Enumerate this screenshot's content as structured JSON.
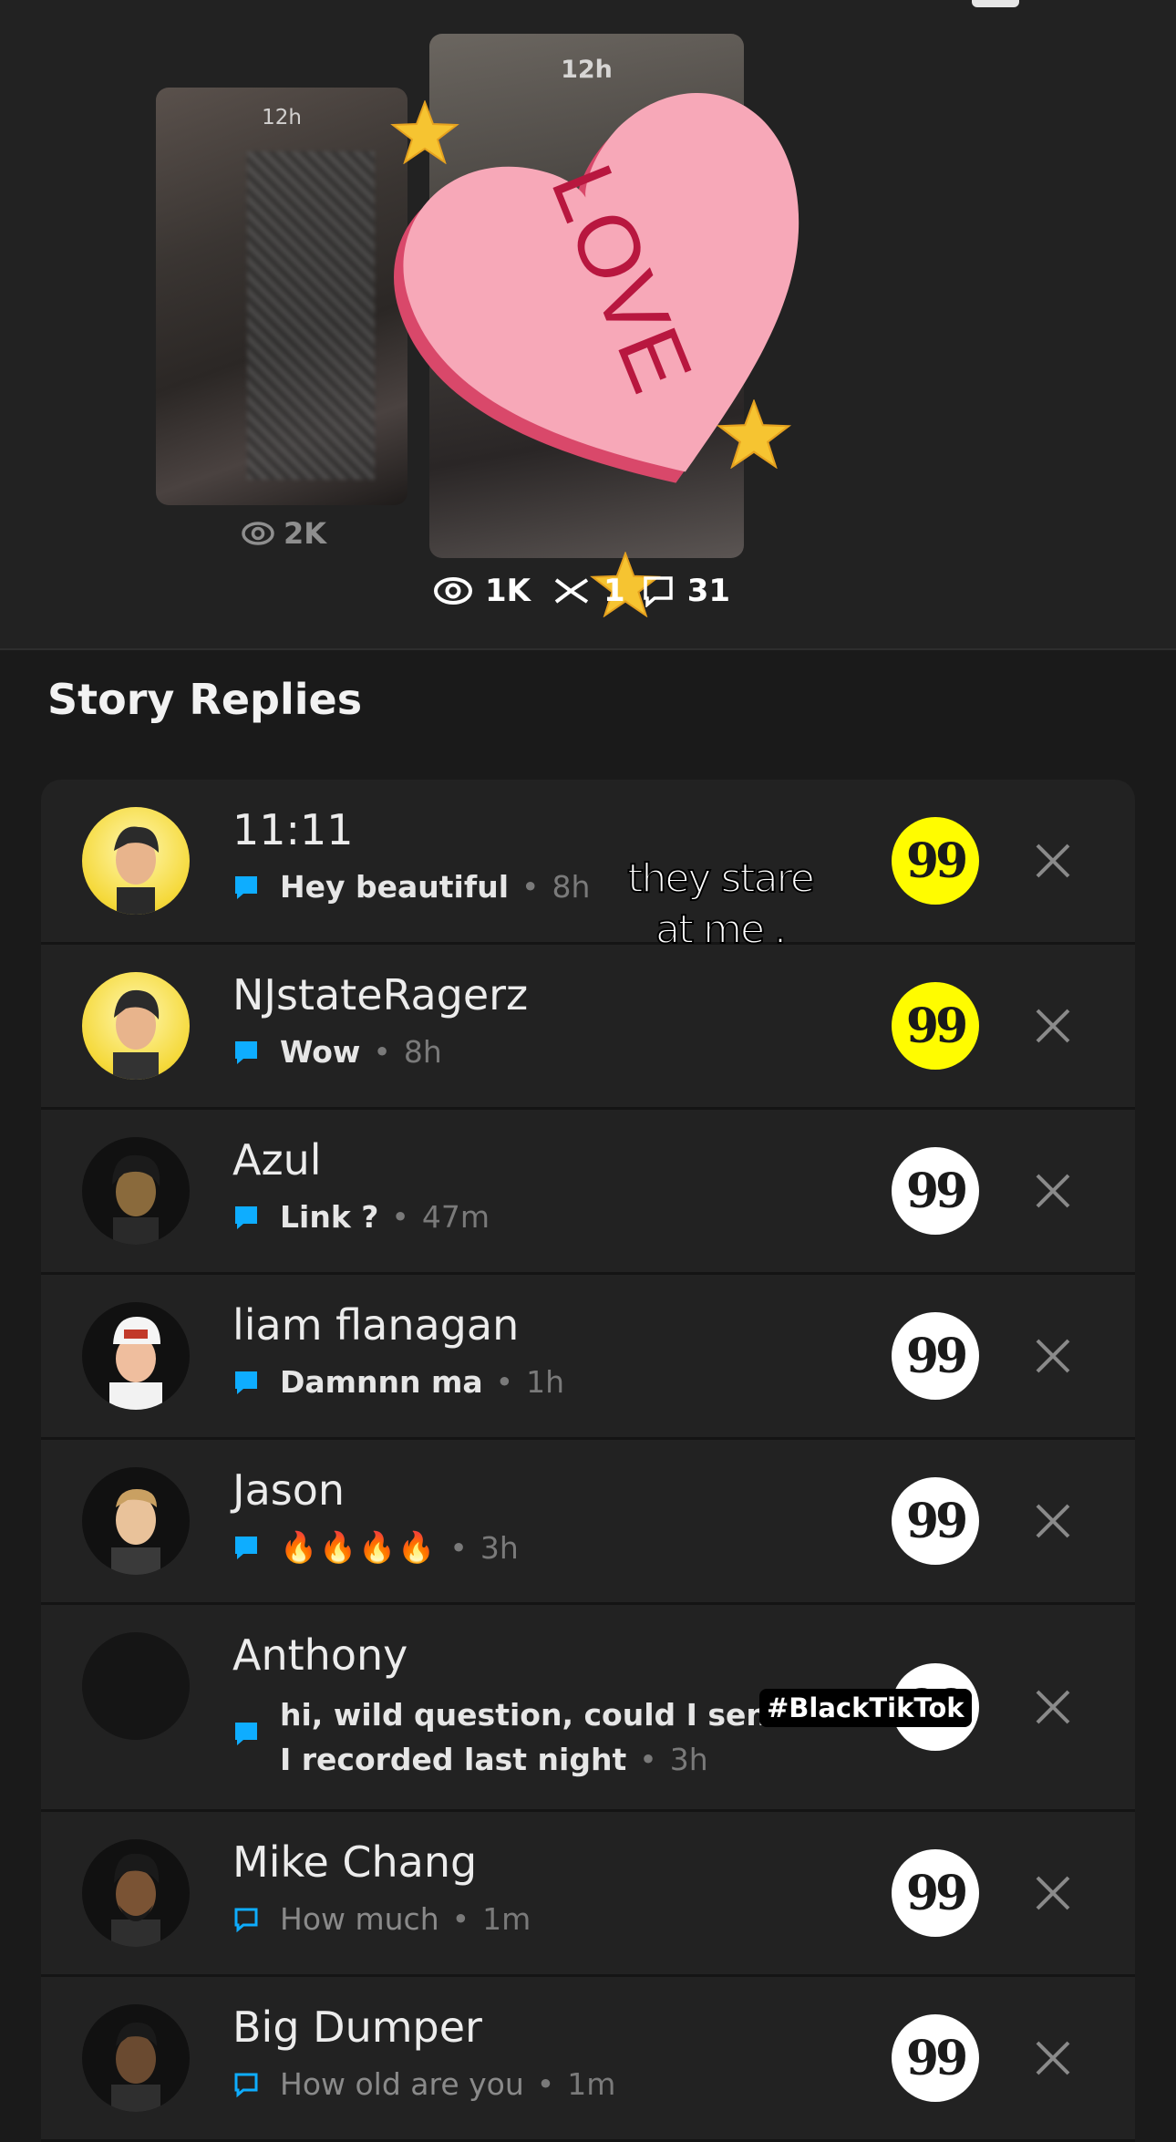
{
  "story_preview": {
    "left_story": {
      "time": "12h",
      "views": "2K"
    },
    "main_story": {
      "time": "12h",
      "sticker_text": "LOVE",
      "views": "1K",
      "screenshots": "1",
      "replies": "31"
    }
  },
  "section_title": "Story Replies",
  "replies": [
    {
      "name": "11:11",
      "message": "Hey beautiful",
      "time": "8h",
      "reply_icon": "quote-icon",
      "highlight": true
    },
    {
      "name": "NJstateRagerz",
      "message": "Wow",
      "time": "8h",
      "reply_icon": "quote-icon",
      "highlight": true
    },
    {
      "name": "Azul",
      "message": "Link ?",
      "time": "47m",
      "reply_icon": "quote-icon",
      "highlight": false
    },
    {
      "name": "liam flanagan",
      "message": "Damnnn ma",
      "time": "1h",
      "reply_icon": "quote-icon",
      "highlight": false
    },
    {
      "name": "Jason",
      "message": "🔥🔥🔥🔥",
      "time": "3h",
      "reply_icon": "quote-icon",
      "highlight": false
    },
    {
      "name": "Anthony",
      "message_line1": "hi, wild question, could I send a",
      "message_line2": "I recorded last night",
      "time": "3h",
      "reply_icon": "quote-icon",
      "highlight": false
    },
    {
      "name": "Mike Chang",
      "message": "How much",
      "time": "1m",
      "reply_icon": "quote-icon",
      "highlight": false,
      "unread": true
    },
    {
      "name": "Big Dumper",
      "message": "How old are you",
      "time": "1m",
      "reply_icon": "quote-icon",
      "highlight": false,
      "unread": true
    }
  ],
  "overlays": {
    "caption_line1": "they stare",
    "caption_line2": "at me .",
    "hashtag": "#BlackTikTok"
  },
  "colors": {
    "accent_yellow": "#FFFC00",
    "chat_blue": "#0EADFF",
    "background": "#1a1a1a",
    "row_background": "#222222"
  }
}
